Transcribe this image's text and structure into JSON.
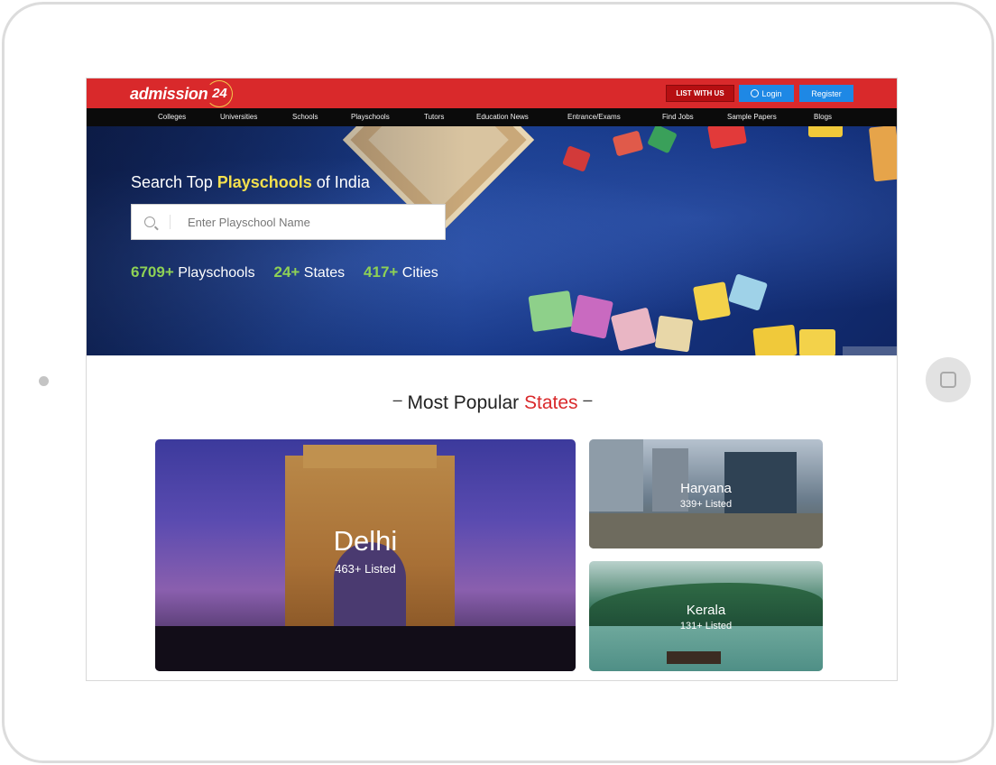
{
  "header": {
    "logo_text": "admission",
    "logo_number": "24",
    "list_with_us": "LIST WITH US",
    "login": "Login",
    "register": "Register"
  },
  "nav": [
    "Colleges",
    "Universities",
    "Schools",
    "Playschools",
    "Tutors",
    "Education News",
    "Entrance/Exams",
    "Find Jobs",
    "Sample Papers",
    "Blogs"
  ],
  "hero": {
    "title_prefix": "Search Top ",
    "title_highlight": "Playschools",
    "title_suffix": " of India",
    "search_placeholder": "Enter Playschool Name",
    "stat1_value": "6709+",
    "stat1_label": "Playschools",
    "stat2_value": "24+",
    "stat2_label": "States",
    "stat3_value": "417+",
    "stat3_label": "Cities"
  },
  "section": {
    "title_prefix": "Most Popular ",
    "title_highlight": "States"
  },
  "states": [
    {
      "name": "Delhi",
      "count": "463+ Listed"
    },
    {
      "name": "Haryana",
      "count": "339+ Listed"
    },
    {
      "name": "Kerala",
      "count": "131+ Listed"
    }
  ],
  "colors": {
    "brand_red": "#d9292b",
    "nav_black": "#0b0b0b",
    "button_blue": "#1e88e5",
    "stat_green": "#8ed155",
    "title_yellow": "#f4e04d"
  },
  "icons": [
    "user-icon",
    "search-icon",
    "home-button-icon"
  ]
}
